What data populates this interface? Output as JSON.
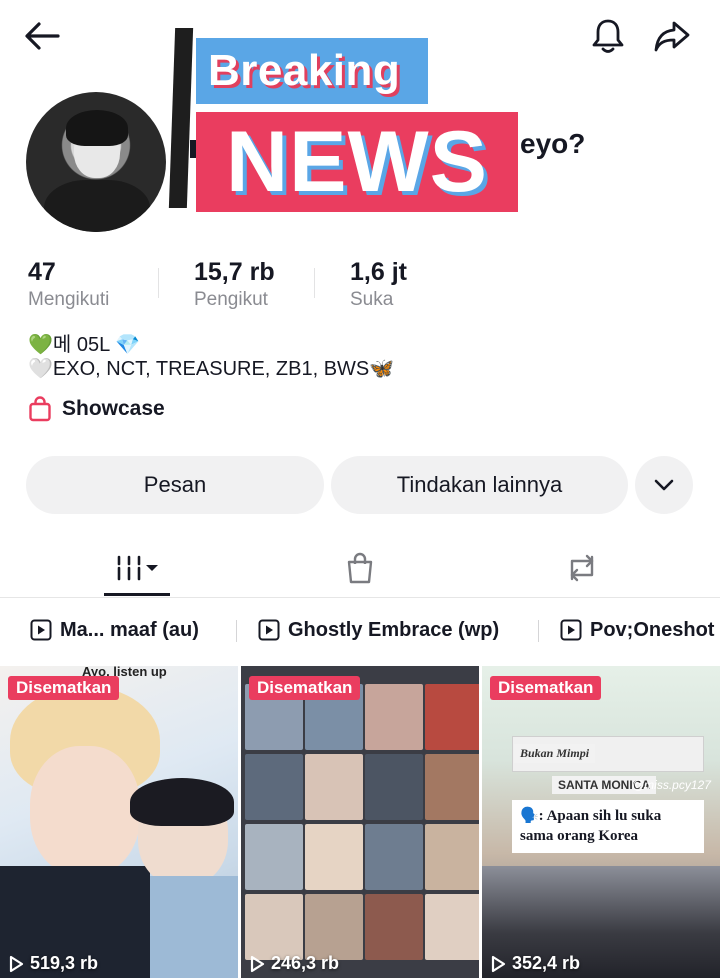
{
  "header": {
    "back_icon": "arrow-left-icon",
    "bell_icon": "bell-icon",
    "share_icon": "share-arrow-icon"
  },
  "overlay": {
    "breaking": "Breaking",
    "news": "NEWS"
  },
  "profile": {
    "name_visible": "eyo?"
  },
  "stats": [
    {
      "value": "47",
      "label": "Mengikuti"
    },
    {
      "value": "15,7 rb",
      "label": "Pengikut"
    },
    {
      "value": "1,6 jt",
      "label": "Suka"
    }
  ],
  "bio": {
    "line1": "💚메 05L 💎",
    "line2": "🤍EXO, NCT, TREASURE, ZB1, BWS🦋",
    "showcase": "Showcase"
  },
  "actions": {
    "message": "Pesan",
    "more": "Tindakan lainnya"
  },
  "tabs": [
    "videos-grid-icon",
    "shopping-bag-icon",
    "repost-icon"
  ],
  "playlists": [
    {
      "label": "Ma... maaf (au)"
    },
    {
      "label": "Ghostly Embrace (wp)"
    },
    {
      "label": "Pov;Oneshot"
    }
  ],
  "videos": [
    {
      "badge": "Disematkan",
      "views": "519,3 rb",
      "caption": "Ayo, listen up"
    },
    {
      "badge": "Disematkan",
      "views": "246,3 rb"
    },
    {
      "badge": "Disematkan",
      "views": "352,4 rb",
      "caption_top": "Bukan Mimpi",
      "caption_sign": "SANTA MONICA",
      "caption_handle": "@miss.pcy127",
      "caption_main": "🗣️: Apaan sih lu suka sama orang Korea"
    }
  ],
  "colors": {
    "accent_pink": "#ea3d5f",
    "overlay_blue": "#5aa6e6",
    "text": "#161823",
    "muted": "#8a8b91"
  }
}
